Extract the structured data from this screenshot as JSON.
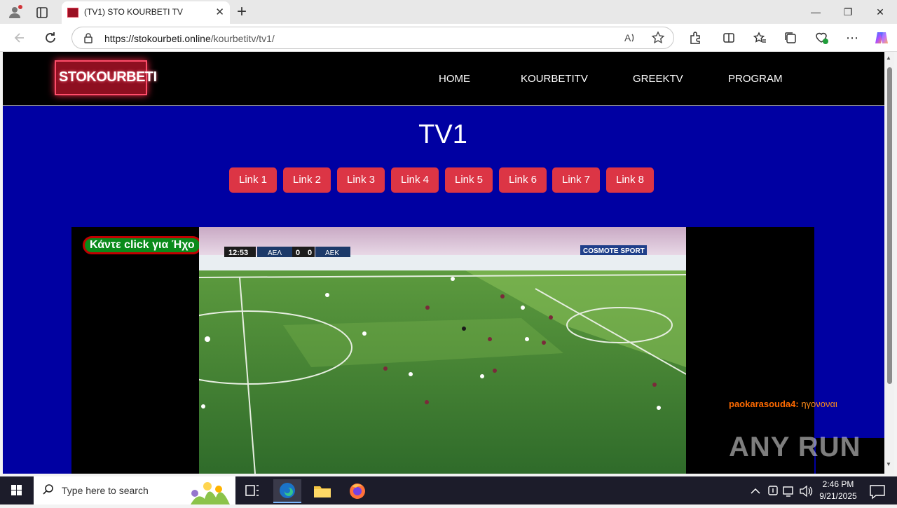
{
  "browser": {
    "tab_title": "(TV1) STO KOURBETI TV",
    "tab_close_glyph": "✕",
    "new_tab_glyph": "+",
    "url_host": "https://stokourbeti.online",
    "url_path": "/kourbetitv/tv1/",
    "minimize_glyph": "—",
    "restore_glyph": "❐",
    "close_glyph": "✕"
  },
  "site": {
    "logo_text": "STOKOURBETI",
    "nav": [
      "HOME",
      "KOURBETITV",
      "GREEKTV",
      "PROGRAM"
    ],
    "page_title": "TV1",
    "links": [
      "Link 1",
      "Link 2",
      "Link 3",
      "Link 4",
      "Link 5",
      "Link 6",
      "Link 7",
      "Link 8"
    ],
    "sound_button": "Κάντε click για Ήχο",
    "ticker_user": "paokarasouda4:",
    "ticker_msg": "ηγονοναι"
  },
  "video": {
    "clock": "12:53",
    "team_home": "ΑΕΛ",
    "score_home": "0",
    "score_away": "0",
    "team_away": "ΑΕΚ",
    "ad_board": "COSMOTE SPORT"
  },
  "watermark": "ANY RUN",
  "taskbar": {
    "search_placeholder": "Type here to search",
    "time": "2:46 PM",
    "date": "9/21/2025"
  },
  "colors": {
    "page_bg": "#0000a2",
    "link_button": "#dc3545",
    "sound_pill_bg": "#0a8a1a",
    "sound_pill_border": "#c00000",
    "ticker": "#ff6a00"
  }
}
